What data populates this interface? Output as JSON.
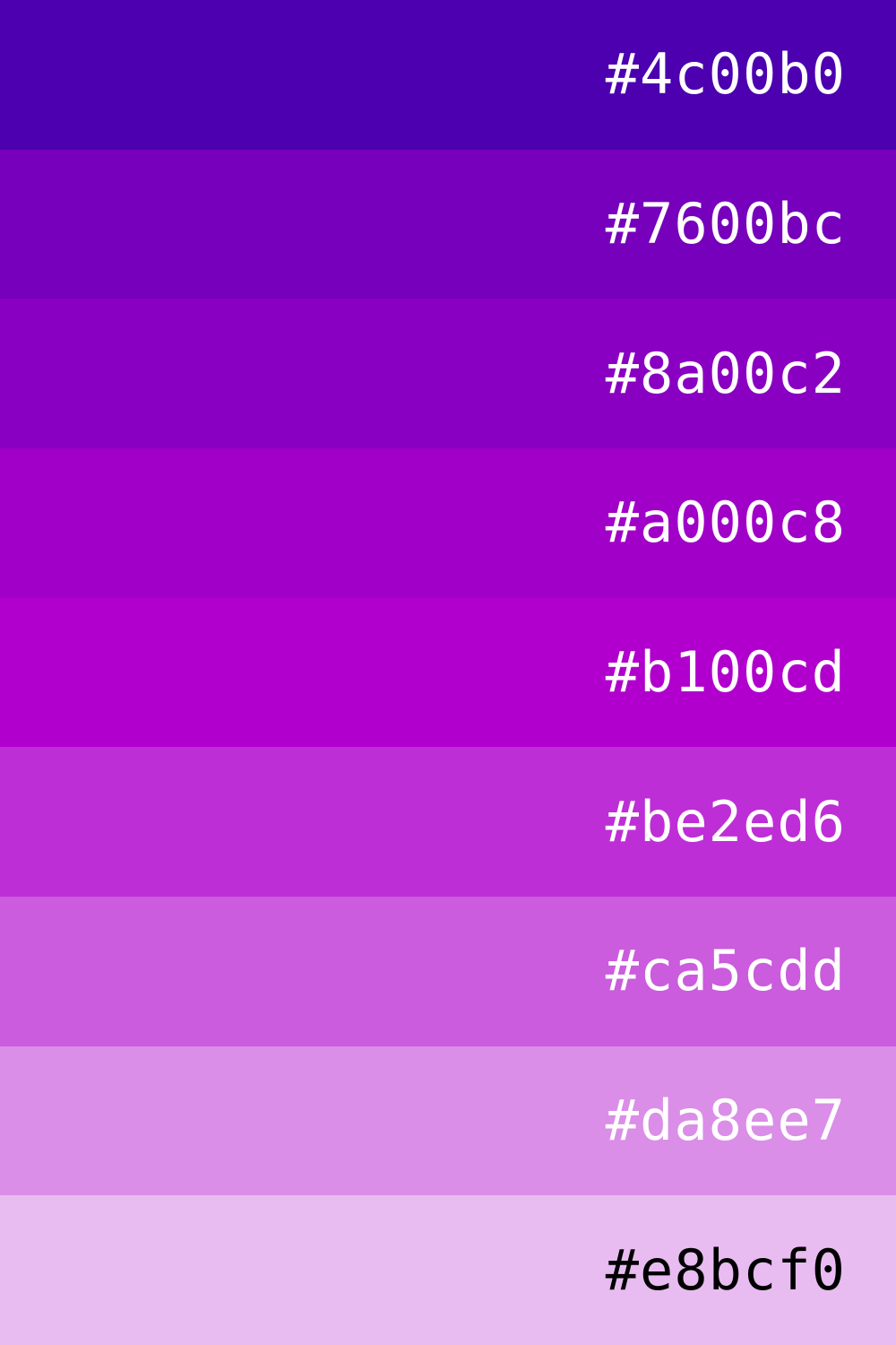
{
  "swatches": [
    {
      "label": "#4c00b0",
      "color": "#4c00b0",
      "text_color": "#ffffff"
    },
    {
      "label": "#7600bc",
      "color": "#7600bc",
      "text_color": "#ffffff"
    },
    {
      "label": "#8a00c2",
      "color": "#8a00c2",
      "text_color": "#ffffff"
    },
    {
      "label": "#a000c8",
      "color": "#a000c8",
      "text_color": "#ffffff"
    },
    {
      "label": "#b100cd",
      "color": "#b100cd",
      "text_color": "#ffffff"
    },
    {
      "label": "#be2ed6",
      "color": "#be2ed6",
      "text_color": "#ffffff"
    },
    {
      "label": "#ca5cdd",
      "color": "#ca5cdd",
      "text_color": "#ffffff"
    },
    {
      "label": "#da8ee7",
      "color": "#da8ee7",
      "text_color": "#ffffff"
    },
    {
      "label": "#e8bcf0",
      "color": "#e8bcf0",
      "text_color": "#000000"
    }
  ]
}
